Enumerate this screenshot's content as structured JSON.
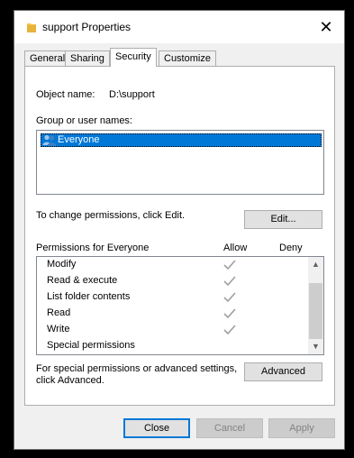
{
  "window": {
    "title": "support Properties",
    "close_glyph": "✕"
  },
  "tabs": [
    {
      "label": "General",
      "active": false
    },
    {
      "label": "Sharing",
      "active": false
    },
    {
      "label": "Security",
      "active": true
    },
    {
      "label": "Customize",
      "active": false
    }
  ],
  "security": {
    "object_name_label": "Object name:",
    "object_name_value": "D:\\support",
    "group_label": "Group or user names:",
    "groups": [
      {
        "name": "Everyone",
        "selected": true
      }
    ],
    "change_hint": "To change permissions, click Edit.",
    "edit_button": "Edit...",
    "permissions_label": "Permissions for Everyone",
    "allow_header": "Allow",
    "deny_header": "Deny",
    "permissions": [
      {
        "name": "Modify",
        "allow": true,
        "deny": false
      },
      {
        "name": "Read & execute",
        "allow": true,
        "deny": false
      },
      {
        "name": "List folder contents",
        "allow": true,
        "deny": false
      },
      {
        "name": "Read",
        "allow": true,
        "deny": false
      },
      {
        "name": "Write",
        "allow": true,
        "deny": false
      },
      {
        "name": "Special permissions",
        "allow": false,
        "deny": false
      }
    ],
    "advanced_hint_line1": "For special permissions or advanced settings,",
    "advanced_hint_line2": "click Advanced.",
    "advanced_button": "Advanced"
  },
  "footer": {
    "close_button": "Close",
    "cancel_button": "Cancel",
    "apply_button": "Apply"
  },
  "colors": {
    "selection": "#0078d7",
    "check": "#a0a0a0",
    "folder": "#f3c14b"
  },
  "icons": {
    "title": "folder-icon",
    "group": "users-icon",
    "permission": "checkmark-icon"
  }
}
